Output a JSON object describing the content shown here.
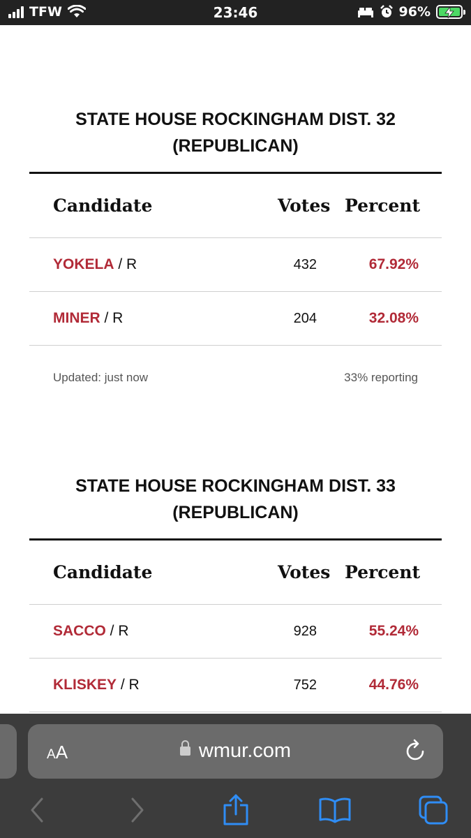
{
  "status_bar": {
    "carrier": "TFW",
    "time": "23:46",
    "battery": "96%",
    "colors": {
      "battery_fill": "#4cd964"
    }
  },
  "races": [
    {
      "title_line1": "STATE HOUSE ROCKINGHAM DIST. 32",
      "title_line2": "(REPUBLICAN)",
      "headers": {
        "candidate": "Candidate",
        "votes": "Votes",
        "percent": "Percent"
      },
      "candidates": [
        {
          "name": "YOKELA",
          "party": " / R",
          "votes": "432",
          "percent": "67.92%"
        },
        {
          "name": "MINER",
          "party": " / R",
          "votes": "204",
          "percent": "32.08%"
        }
      ],
      "updated": "Updated: just now",
      "reporting": "33% reporting"
    },
    {
      "title_line1": "STATE HOUSE ROCKINGHAM DIST. 33",
      "title_line2": "(REPUBLICAN)",
      "headers": {
        "candidate": "Candidate",
        "votes": "Votes",
        "percent": "Percent"
      },
      "candidates": [
        {
          "name": "SACCO",
          "party": " / R",
          "votes": "928",
          "percent": "55.24%"
        },
        {
          "name": "KLISKEY",
          "party": " / R",
          "votes": "752",
          "percent": "44.76%"
        }
      ]
    }
  ],
  "browser": {
    "text_size_small": "A",
    "text_size_large": "A",
    "domain": "wmur.com",
    "icons": [
      "lock-icon",
      "reload-icon",
      "back-icon",
      "forward-icon",
      "share-icon",
      "bookmarks-icon",
      "tabs-icon"
    ]
  },
  "colors": {
    "accent": "#b12a37",
    "link_blue": "#2f8df5"
  }
}
